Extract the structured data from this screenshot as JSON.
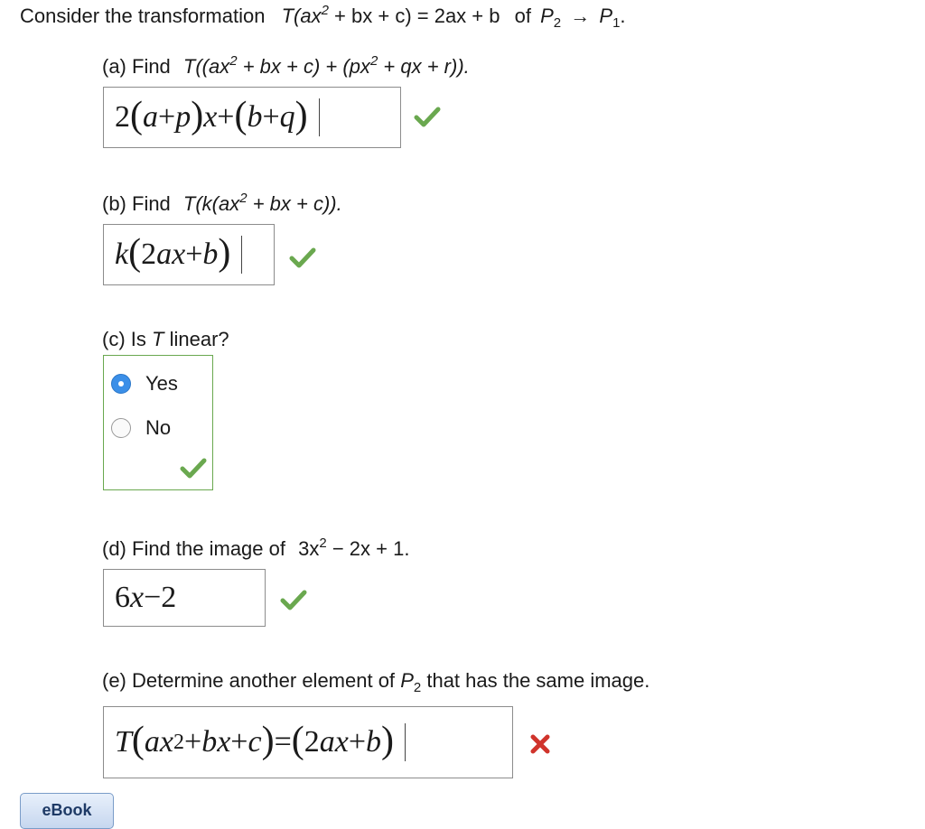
{
  "header": {
    "prefix": "Consider the transformation",
    "formula_T": "T(ax",
    "formula_sup": "2",
    "formula_rest": " + bx + c) = 2ax + b",
    "of_text": "of",
    "space_a": "P",
    "space_a_sub": "2",
    "arrow": "→",
    "space_b": "P",
    "space_b_sub": "1",
    "period": "."
  },
  "part_a": {
    "label": "(a) Find",
    "expr_1": "T((ax",
    "sup_1": "2",
    "expr_2": " + bx + c) + (px",
    "sup_2": "2",
    "expr_3": " + qx + r)).",
    "answer": {
      "p1": "2",
      "p2": "(",
      "p3": "a",
      "p4": " + ",
      "p5": "p",
      "p6": ")",
      "p7": "x",
      "p8": " + ",
      "p9": "(",
      "p10": "b",
      "p11": " + ",
      "p12": "q",
      "p13": ")"
    },
    "status": "correct"
  },
  "part_b": {
    "label": "(b) Find",
    "expr_1": "T(k(ax",
    "sup_1": "2",
    "expr_2": " + bx + c)).",
    "answer": {
      "p1": "k",
      "p2": "(",
      "p3": "2",
      "p4": "ax",
      "p5": " + ",
      "p6": "b",
      "p7": ")"
    },
    "status": "correct"
  },
  "part_c": {
    "label_1": "(c) Is",
    "label_T": "T",
    "label_2": "linear?",
    "options": [
      {
        "label": "Yes",
        "selected": true
      },
      {
        "label": "No",
        "selected": false
      }
    ],
    "status": "correct"
  },
  "part_d": {
    "label": "(d) Find the image of",
    "expr_1": "3x",
    "sup_1": "2",
    "expr_2": " − 2x + 1.",
    "answer": {
      "p1": "6",
      "p2": "x",
      "p3": " − ",
      "p4": "2"
    },
    "status": "correct"
  },
  "part_e": {
    "label_1": "(e) Determine another element of",
    "space": "P",
    "space_sub": "2",
    "label_2": "that has the same image.",
    "answer": {
      "p1": "T",
      "p2": "(",
      "p3": "ax",
      "p4": "2",
      "p5": " + ",
      "p6": "bx",
      "p7": " + ",
      "p8": "c",
      "p9": ")",
      "p10": " = ",
      "p11": "(",
      "p12": "2",
      "p13": "ax",
      "p14": " + ",
      "p15": "b",
      "p16": ")"
    },
    "status": "incorrect"
  },
  "ebook_button": {
    "label": "eBook"
  },
  "colors": {
    "correct": "#6aa84f",
    "incorrect": "#d0342c",
    "radio_selected": "#3b8fe8"
  },
  "icons": {
    "correct": "check-icon",
    "incorrect": "x-icon"
  }
}
